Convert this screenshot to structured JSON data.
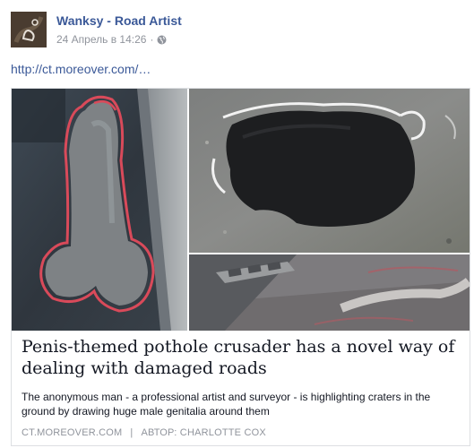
{
  "post": {
    "author": "Wanksy - Road Artist",
    "timestamp": "24 Апрель в 14:26",
    "separator": "·",
    "privacy_icon": "globe-icon",
    "link_text": "http://ct.moreover.com/…"
  },
  "attachment": {
    "headline": "Penis-themed pothole crusader has a novel way of dealing with damaged roads",
    "description": "The anonymous man - a professional artist and surveyor - is highlighting craters in the ground by drawing huge male genitalia around them",
    "source": "CT.MOREOVER.COM",
    "source_separator": "|",
    "author_line": "АВТОР: CHARLOTTE COX"
  },
  "colors": {
    "link": "#3b5998",
    "meta": "#90949c",
    "paint_red": "#d94a5a",
    "paint_white": "#f2f2f2",
    "asphalt": "#3a3d42"
  }
}
